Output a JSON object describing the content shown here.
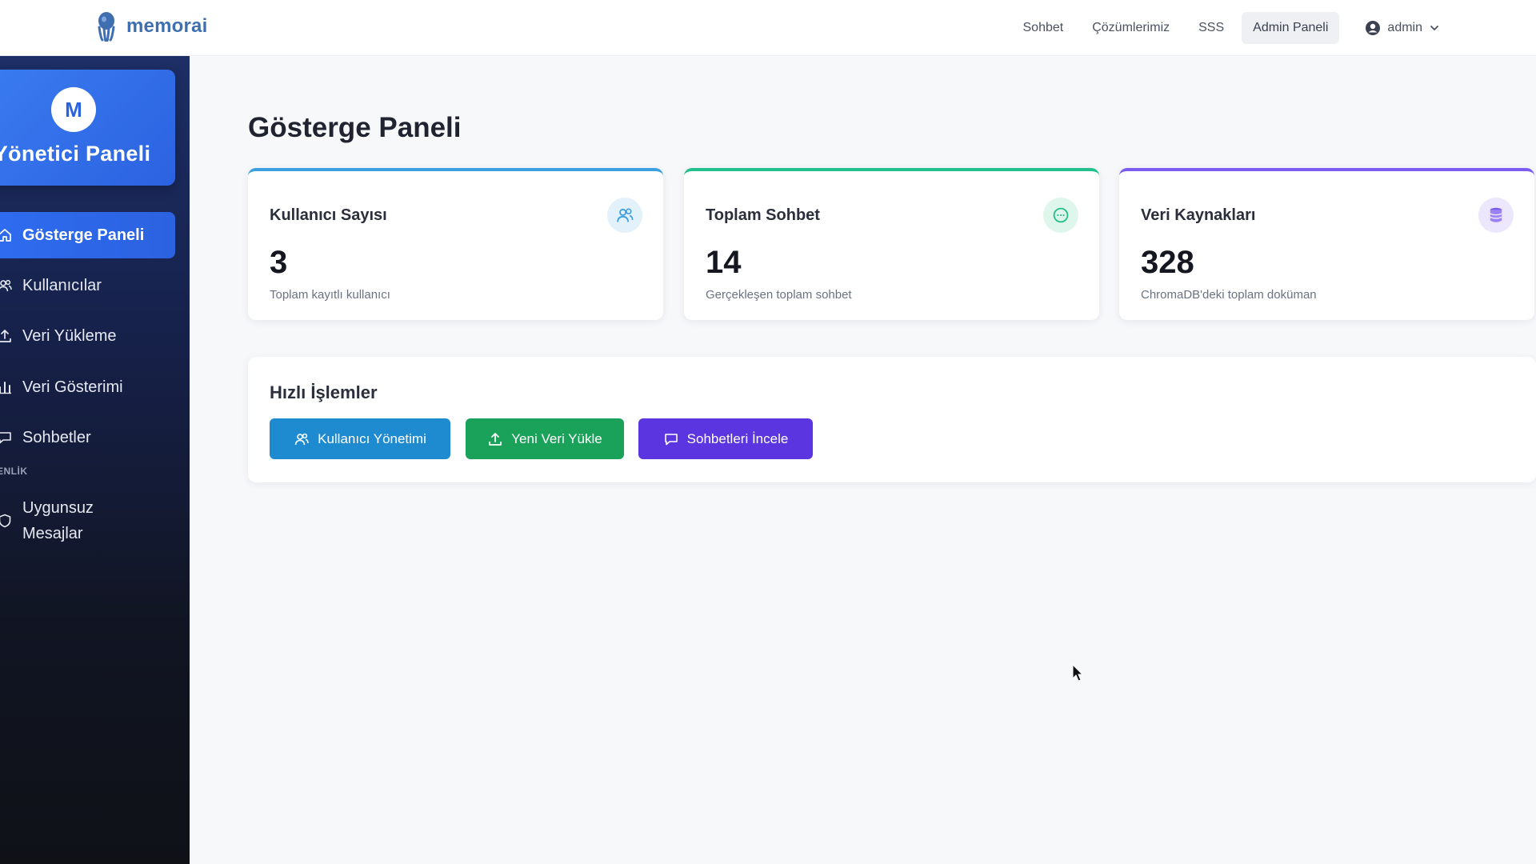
{
  "brand": {
    "name": "memorai"
  },
  "nav": {
    "links": [
      "Sohbet",
      "Çözümlerimiz",
      "SSS",
      "Admin Paneli"
    ],
    "active": "Admin Paneli",
    "user": "admin"
  },
  "sidebar": {
    "avatar_letter": "M",
    "title": "Yönetici Paneli",
    "items": [
      {
        "label": "Gösterge Paneli",
        "icon": "home-icon"
      },
      {
        "label": "Kullanıcılar",
        "icon": "users-icon"
      },
      {
        "label": "Veri Yükleme",
        "icon": "upload-icon"
      },
      {
        "label": "Veri Gösterimi",
        "icon": "bar-chart-icon"
      },
      {
        "label": "Sohbetler",
        "icon": "chat-icon"
      }
    ],
    "section_label": "ENLİK",
    "section_items": [
      {
        "label": "Uygunsuz Mesajlar",
        "icon": "shield-icon"
      }
    ]
  },
  "main": {
    "title": "Gösterge Paneli",
    "cards": [
      {
        "label": "Kullanıcı Sayısı",
        "value": "3",
        "sub": "Toplam kayıtlı kullanıcı",
        "icon": "users-icon",
        "color": "#3b9fe0"
      },
      {
        "label": "Toplam Sohbet",
        "value": "14",
        "sub": "Gerçekleşen toplam sohbet",
        "icon": "chat-bubble-icon",
        "color": "#22c08a"
      },
      {
        "label": "Veri Kaynakları",
        "value": "328",
        "sub": "ChromaDB'deki toplam doküman",
        "icon": "database-icon",
        "color": "#7c5cf0"
      }
    ],
    "quick_actions": {
      "title": "Hızlı İşlemler",
      "buttons": [
        {
          "label": "Kullanıcı Yönetimi",
          "icon": "users-icon",
          "color": "#1e8bd1"
        },
        {
          "label": "Yeni Veri Yükle",
          "icon": "upload-icon",
          "color": "#1ba25a"
        },
        {
          "label": "Sohbetleri İncele",
          "icon": "chat-icon",
          "color": "#5b35e0"
        }
      ]
    }
  }
}
